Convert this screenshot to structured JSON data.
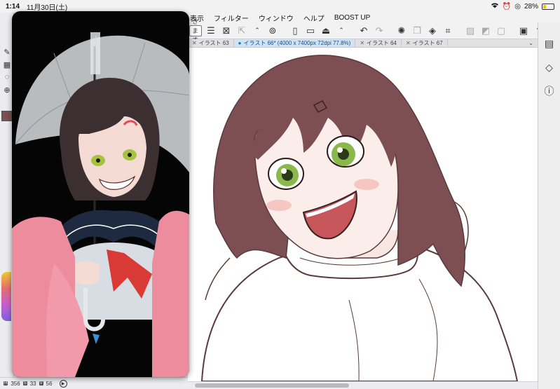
{
  "status_bar": {
    "time": "1:14",
    "date": "11月30日(土)",
    "battery_percent": "28%",
    "battery_level": 0.28,
    "icons": [
      "wifi-icon",
      "alarm-icon",
      "rotation-lock-icon",
      "battery-icon"
    ]
  },
  "menu": {
    "items": [
      "表示",
      "フィルター",
      "ウィンドウ",
      "ヘルプ",
      "BOOST UP"
    ]
  },
  "toolbar": {
    "save_label": "きます",
    "icons": [
      "menu-icon",
      "fit-screen-icon",
      "export-icon",
      "stepper-icon",
      "cloud-icon",
      "new-file-icon",
      "open-folder-icon",
      "save-icon",
      "more-stepper-icon",
      "undo-icon",
      "redo-icon",
      "loading-icon",
      "copy-icon",
      "fill-icon",
      "crop-icon",
      "clear-icon",
      "layer-mask-icon",
      "frame-icon",
      "tablet-icon",
      "help-icon"
    ]
  },
  "tabs": [
    {
      "label": "イラスト 63",
      "active": false
    },
    {
      "label": "イラスト 66* (4000 x 7400px 72dpi 77.8%)",
      "active": true
    },
    {
      "label": "イラスト 64",
      "active": false
    },
    {
      "label": "イラスト 67",
      "active": false
    }
  ],
  "footer": {
    "h_tag": "H",
    "h_value": "356",
    "s_tag": "S",
    "s_value": "33",
    "v_tag": "V",
    "v_value": "56"
  },
  "right_panel": {
    "icons": [
      "list-panel-icon",
      "layers-icon",
      "info-icon"
    ]
  },
  "colors": {
    "main_color": "#7d4f52",
    "active_tab_bg": "#cfe3f5"
  }
}
